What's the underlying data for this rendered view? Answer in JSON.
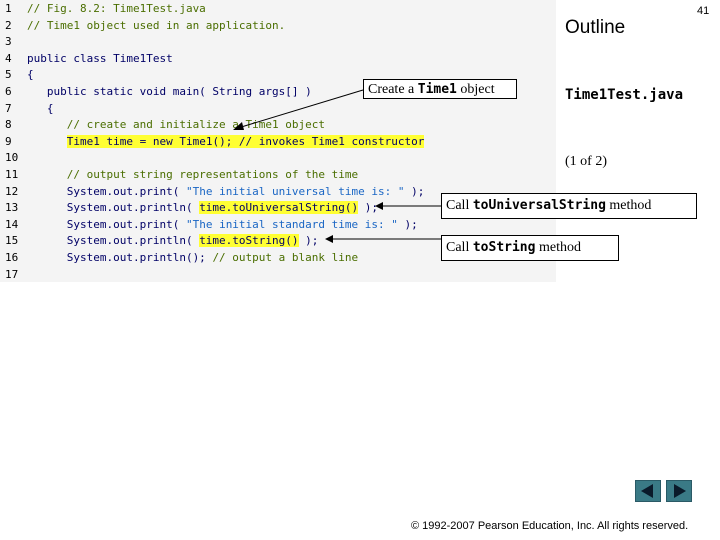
{
  "slide": {
    "outline_title": "Outline",
    "page_number": "41",
    "file_name": "Time1Test.java",
    "page_of": "(1 of 2)",
    "copyright": "© 1992-2007 Pearson Education, Inc.  All rights reserved."
  },
  "code": {
    "lines": [
      {
        "n": "1",
        "segments": [
          {
            "t": "// Fig. 8.2: Time1Test.java",
            "c": "comment"
          }
        ]
      },
      {
        "n": "2",
        "segments": [
          {
            "t": "// Time1 object used in an application.",
            "c": "comment"
          }
        ]
      },
      {
        "n": "3",
        "segments": []
      },
      {
        "n": "4",
        "segments": [
          {
            "t": "public class Time1Test",
            "c": "kw"
          }
        ]
      },
      {
        "n": "5",
        "segments": [
          {
            "t": "{",
            "c": "kw"
          }
        ]
      },
      {
        "n": "6",
        "segments": [
          {
            "t": "   public static void main( String args[] )",
            "c": "kw"
          }
        ]
      },
      {
        "n": "7",
        "segments": [
          {
            "t": "   {",
            "c": "kw"
          }
        ]
      },
      {
        "n": "8",
        "segments": [
          {
            "t": "      // create and initialize a Time1 object",
            "c": "comment"
          }
        ]
      },
      {
        "n": "9",
        "segments": [
          {
            "t": "      ",
            "c": "kw"
          },
          {
            "t": "Time1 time = new Time1(); // invokes Time1 constructor",
            "c": "hl"
          }
        ]
      },
      {
        "n": "10",
        "segments": []
      },
      {
        "n": "11",
        "segments": [
          {
            "t": "      // output string representations of the time",
            "c": "comment"
          }
        ]
      },
      {
        "n": "12",
        "segments": [
          {
            "t": "      System.out.print( ",
            "c": "kw"
          },
          {
            "t": "\"The initial universal time is: \"",
            "c": "str"
          },
          {
            "t": " );",
            "c": "kw"
          }
        ]
      },
      {
        "n": "13",
        "segments": [
          {
            "t": "      System.out.println( ",
            "c": "kw"
          },
          {
            "t": "time.toUniversalString()",
            "c": "hl"
          },
          {
            "t": " );",
            "c": "kw"
          }
        ]
      },
      {
        "n": "14",
        "segments": [
          {
            "t": "      System.out.print( ",
            "c": "kw"
          },
          {
            "t": "\"The initial standard time is: \"",
            "c": "str"
          },
          {
            "t": " );",
            "c": "kw"
          }
        ]
      },
      {
        "n": "15",
        "segments": [
          {
            "t": "      System.out.println( ",
            "c": "kw"
          },
          {
            "t": "time.toString()",
            "c": "hl"
          },
          {
            "t": " );",
            "c": "kw"
          }
        ]
      },
      {
        "n": "16",
        "segments": [
          {
            "t": "      System.out.println(); ",
            "c": "kw"
          },
          {
            "t": "// output a blank line",
            "c": "comment"
          }
        ]
      },
      {
        "n": "17",
        "segments": []
      }
    ]
  },
  "callouts": {
    "c1": {
      "pre": "Create a ",
      "mono": "Time1",
      "post": " object"
    },
    "c2": {
      "pre": "Call ",
      "mono": "toUniversalString",
      "post": " method"
    },
    "c3": {
      "pre": "Call ",
      "mono": "toString",
      "post": " method"
    }
  },
  "nav": {
    "prev_icon": "triangle-left-icon",
    "next_icon": "triangle-right-icon",
    "color": "#3a7a86"
  }
}
